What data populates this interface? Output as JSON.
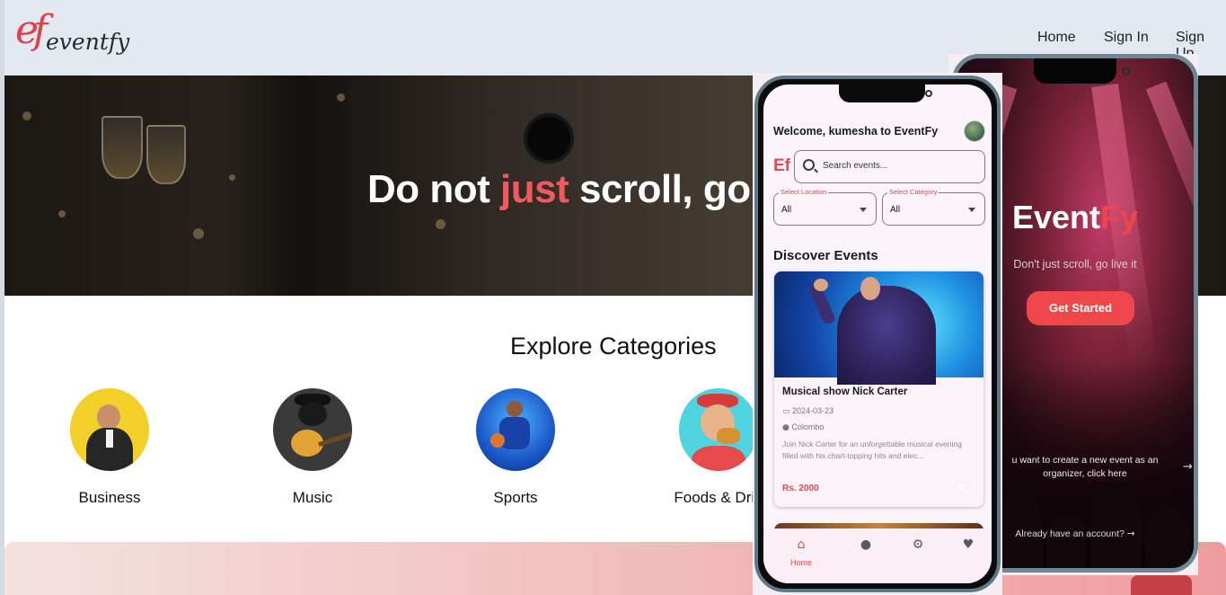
{
  "site": {
    "logo_mark": "ef",
    "logo_word": "eventfy",
    "nav": [
      "Home",
      "Sign In",
      "Sign Up"
    ]
  },
  "hero": {
    "title_before": "Do not ",
    "title_accent": "just",
    "title_after": " scroll, go",
    "accent_color": "#f05a5f"
  },
  "categories": {
    "heading": "Explore Categories",
    "items": [
      {
        "label": "Business",
        "icon": "businessman-image"
      },
      {
        "label": "Music",
        "icon": "guitarist-image"
      },
      {
        "label": "Sports",
        "icon": "basketball-player-image"
      },
      {
        "label": "Foods & Drin",
        "icon": "woman-eating-image"
      }
    ]
  },
  "phone_app": {
    "welcome": "Welcome, kumesha to EventFy",
    "brand_short": "Ef",
    "search_placeholder": "Search events...",
    "location": {
      "caption": "Select Location",
      "value": "All"
    },
    "category": {
      "caption": "Select Category",
      "value": "All"
    },
    "section_title": "Discover Events",
    "event": {
      "title": "Musical show Nick Carter",
      "date": "2024-03-23",
      "location": "Colombo",
      "description": "Join Nick Carter for an unforgettable musical evening filled with his chart-topping hits and elec...",
      "price": "Rs. 2000"
    },
    "bottom_nav": {
      "home_label": "Home",
      "items": [
        "home-icon",
        "profile-icon",
        "settings-icon",
        "favorites-icon"
      ]
    },
    "accent_color": "#e2474d"
  },
  "phone_landing": {
    "brand_event": "Event",
    "brand_fy": "Fy",
    "tagline": "Don't just scroll, go live it",
    "cta": "Get Started",
    "organizer_text": "u want to create a new event as an\norganizer, click here",
    "already_text": "Already have an account?",
    "accent_color": "#f0474d"
  }
}
